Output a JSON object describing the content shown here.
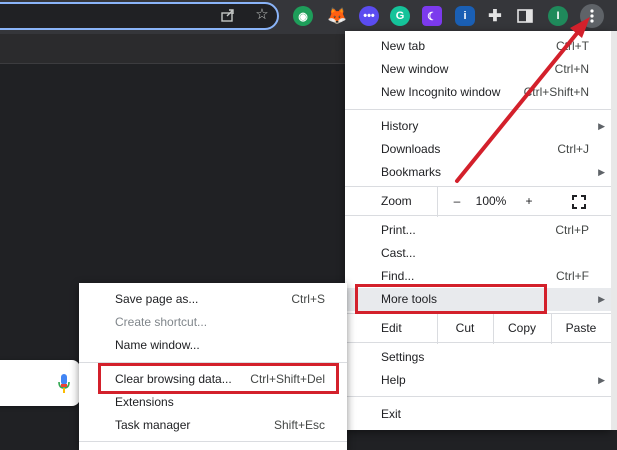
{
  "colors": {
    "accent_red": "#d3202b",
    "focus_blue": "#8ab4f8"
  },
  "toolbar": {
    "share_icon": "share-icon",
    "bookmark_icon": "star-icon",
    "profile_initial": "I",
    "extensions": [
      "grammar-extension-icon",
      "fox-extension-icon",
      "chat-extension-icon",
      "grammarly-extension-icon",
      "moon-extension-icon",
      "info-extension-icon",
      "puzzle-icon",
      "sidepanel-icon"
    ]
  },
  "main_menu": {
    "new_tab": {
      "label": "New tab",
      "shortcut": "Ctrl+T"
    },
    "new_window": {
      "label": "New window",
      "shortcut": "Ctrl+N"
    },
    "new_incognito": {
      "label": "New Incognito window",
      "shortcut": "Ctrl+Shift+N"
    },
    "history": {
      "label": "History"
    },
    "downloads": {
      "label": "Downloads",
      "shortcut": "Ctrl+J"
    },
    "bookmarks": {
      "label": "Bookmarks"
    },
    "zoom": {
      "label": "Zoom",
      "minus": "–",
      "value": "100%",
      "plus": "+"
    },
    "print": {
      "label": "Print...",
      "shortcut": "Ctrl+P"
    },
    "cast": {
      "label": "Cast..."
    },
    "find": {
      "label": "Find...",
      "shortcut": "Ctrl+F"
    },
    "more_tools": {
      "label": "More tools"
    },
    "edit": {
      "label": "Edit",
      "cut": "Cut",
      "copy": "Copy",
      "paste": "Paste"
    },
    "settings": {
      "label": "Settings"
    },
    "help": {
      "label": "Help"
    },
    "exit": {
      "label": "Exit"
    }
  },
  "sub_menu": {
    "save_page": {
      "label": "Save page as...",
      "shortcut": "Ctrl+S"
    },
    "create_shortcut": {
      "label": "Create shortcut..."
    },
    "name_window": {
      "label": "Name window..."
    },
    "clear_data": {
      "label": "Clear browsing data...",
      "shortcut": "Ctrl+Shift+Del"
    },
    "extensions": {
      "label": "Extensions"
    },
    "task_manager": {
      "label": "Task manager",
      "shortcut": "Shift+Esc"
    }
  }
}
